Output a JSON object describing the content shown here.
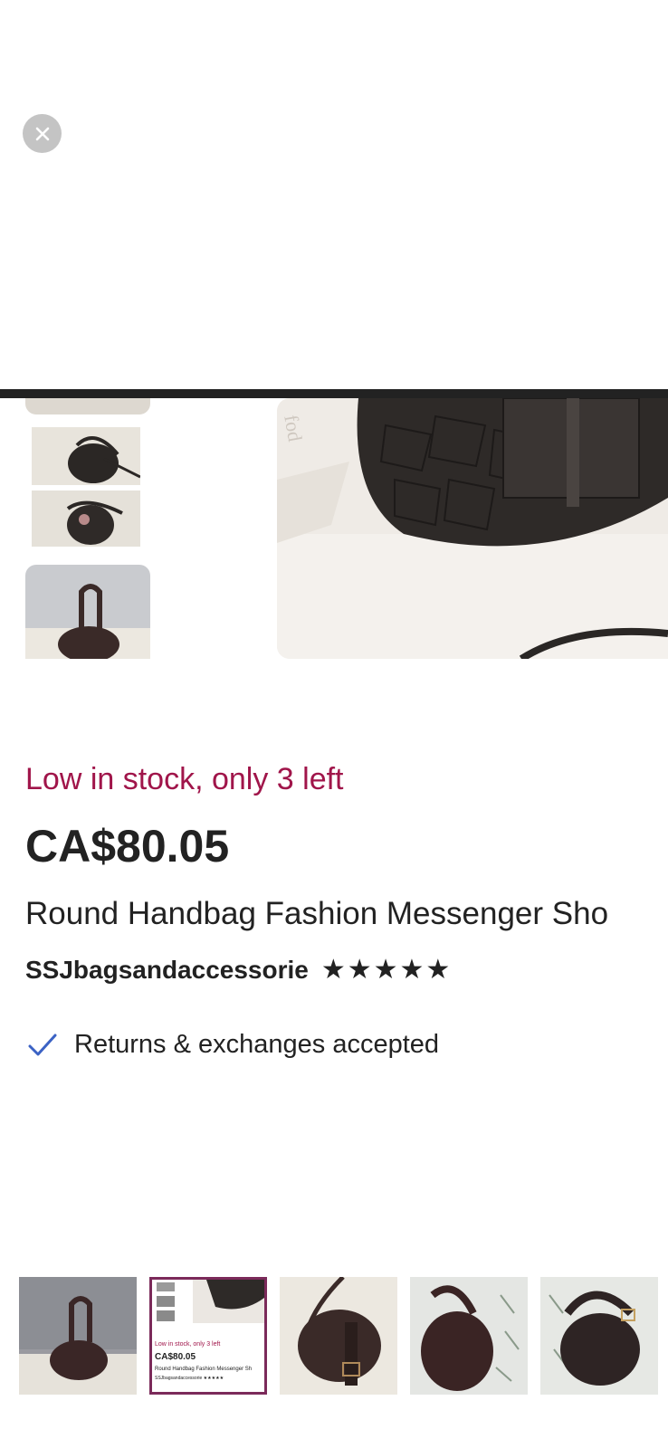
{
  "product": {
    "stock_notice": "Low in stock, only 3 left",
    "price": "CA$80.05",
    "title": "Round Handbag Fashion Messenger Sho",
    "shop_name": "SSJbagsandaccessorie",
    "rating_stars": "★★★★★",
    "returns_text": "Returns & exchanges accepted"
  },
  "strip": {
    "selected_index": 1,
    "mini_stock": "Low in stock, only 3 left",
    "mini_price": "CA$80.05",
    "mini_title": "Round Handbag Fashion Messenger Sh",
    "mini_shop": "SSJbagsandaccessorie ★★★★★"
  },
  "colors": {
    "stock_red": "#a0154a",
    "text": "#222222",
    "check_blue": "#3b62c4",
    "selected_border": "#7b2a5a"
  },
  "icons": [
    "close-icon",
    "checkmark-icon",
    "star-icon"
  ]
}
